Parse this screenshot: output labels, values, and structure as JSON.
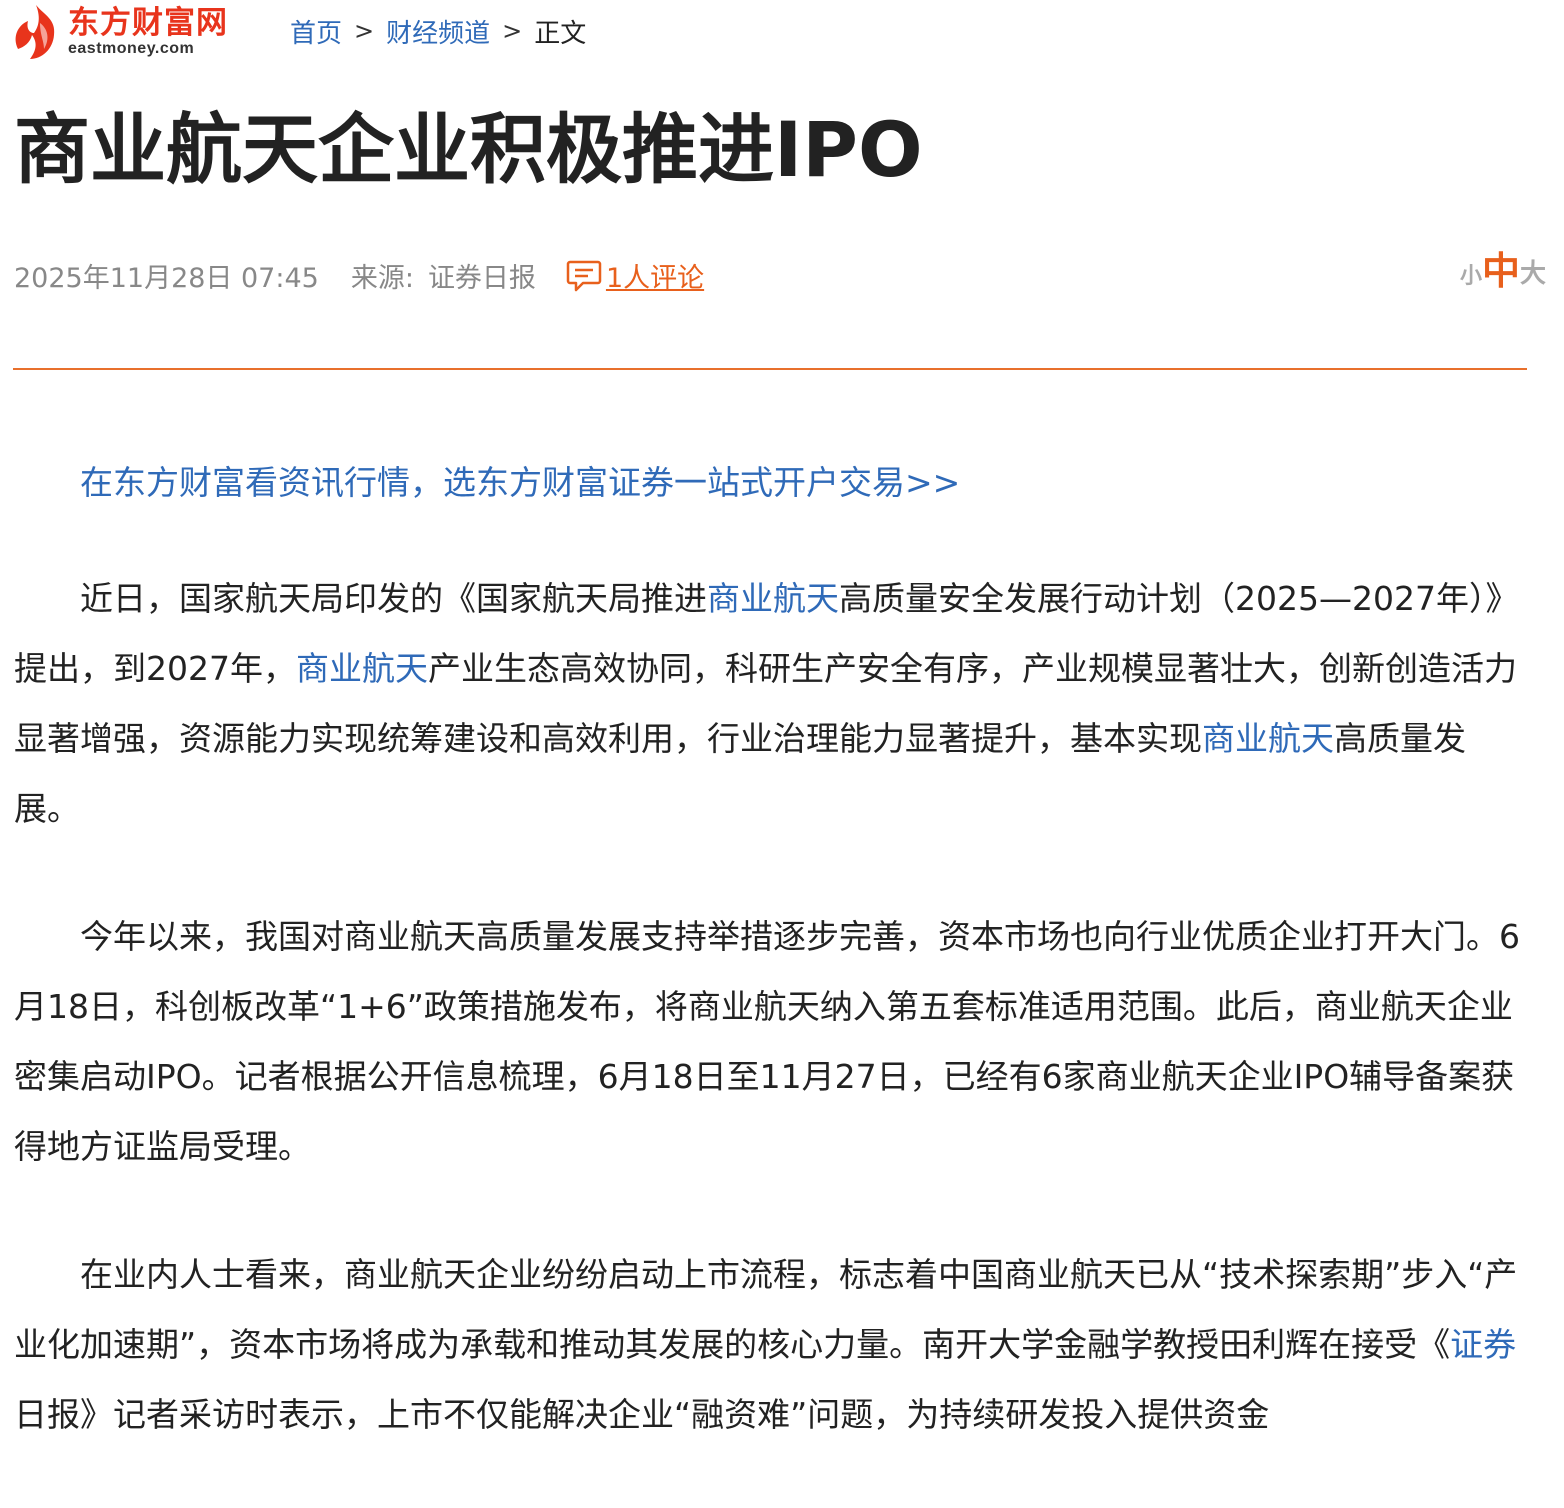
{
  "logo": {
    "name_cn": "东方财富网",
    "domain": "eastmoney.com",
    "brand_color": "#e8341c"
  },
  "breadcrumb": {
    "home": "首页",
    "channel": "财经频道",
    "current": "正文",
    "separator": ">"
  },
  "article": {
    "title": "商业航天企业积极推进IPO",
    "datetime": "2025年11月28日 07:45",
    "source_label": "来源:",
    "source_name": "证券日报",
    "comment_count": "1人评论",
    "promo_link": "在东方财富看资讯行情，选东方财富证券一站式开户交易>>",
    "p1": {
      "t1": "近日，国家航天局印发的《国家航天局推进",
      "l1": "商业航天",
      "t2": "高质量安全发展行动计划（2025—2027年）》提出，到2027年，",
      "l2": "商业航天",
      "t3": "产业生态高效协同，科研生产安全有序，产业规模显著壮大，创新创造活力显著增强，资源能力实现统筹建设和高效利用，行业治理能力显著提升，基本实现",
      "l3": "商业航天",
      "t4": "高质量发展。"
    },
    "p2": "今年以来，我国对商业航天高质量发展支持举措逐步完善，资本市场也向行业优质企业打开大门。6月18日，科创板改革“1+6”政策措施发布，将商业航天纳入第五套标准适用范围。此后，商业航天企业密集启动IPO。记者根据公开信息梳理，6月18日至11月27日，已经有6家商业航天企业IPO辅导备案获得地方证监局受理。",
    "p3": {
      "t1": "在业内人士看来，商业航天企业纷纷启动上市流程，标志着中国商业航天已从“技术探索期”步入“产业化加速期”，资本市场将成为承载和推动其发展的核心力量。南开大学金融学教授田利辉在接受《",
      "l1": "证券",
      "t2": "日报》记者采访时表示，上市不仅能解决企业“融资难”问题，为持续研发投入提供资金"
    }
  },
  "font_size_control": {
    "small": "小",
    "medium": "中",
    "large": "大"
  },
  "colors": {
    "accent": "#e8601c",
    "link": "#2f6ab8",
    "divider": "#e8702c"
  }
}
